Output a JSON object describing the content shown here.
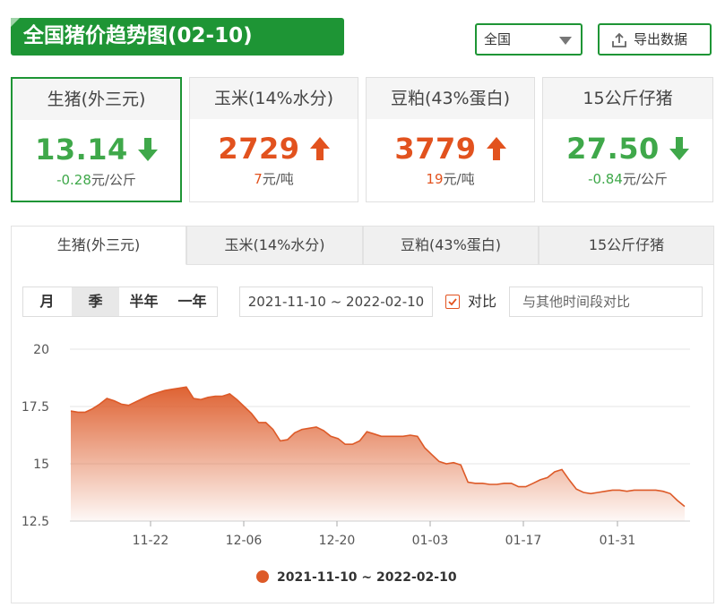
{
  "header": {
    "title": "全国猪价趋势图(02-10)"
  },
  "region": {
    "value": "全国"
  },
  "export": {
    "label": "导出数据"
  },
  "cards": [
    {
      "name": "生猪(外三元)",
      "price": "13.14",
      "direction": "down",
      "change_value": "-0.28",
      "change_unit": "元/公斤"
    },
    {
      "name": "玉米(14%水分)",
      "price": "2729",
      "direction": "up",
      "change_value": "7",
      "change_unit": "元/吨"
    },
    {
      "name": "豆粕(43%蛋白)",
      "price": "3779",
      "direction": "up",
      "change_value": "19",
      "change_unit": "元/吨"
    },
    {
      "name": "15公斤仔猪",
      "price": "27.50",
      "direction": "down",
      "change_value": "-0.84",
      "change_unit": "元/公斤"
    }
  ],
  "tabs": [
    "生猪(外三元)",
    "玉米(14%水分)",
    "豆粕(43%蛋白)",
    "15公斤仔猪"
  ],
  "periods": [
    "月",
    "季",
    "半年",
    "一年"
  ],
  "active_period": "季",
  "date_range": "2021-11-10 ~ 2022-02-10",
  "compare": {
    "checked": true,
    "label": "对比",
    "placeholder": "与其他时间段对比"
  },
  "colors": {
    "green": "#1e9535",
    "up": "#e2521e",
    "down": "#3fa84a",
    "series": "#dd5a28"
  },
  "chart_data": {
    "type": "area",
    "x_ticks": [
      "11-22",
      "12-06",
      "12-20",
      "01-03",
      "01-17",
      "01-31"
    ],
    "y_ticks": [
      "20",
      "17.5",
      "15",
      "12.5"
    ],
    "ylim": [
      12.5,
      20
    ],
    "grid": true,
    "legend_position": "bottom",
    "series": [
      {
        "name": "2021-11-10 ~ 2022-02-10",
        "values": [
          17.3,
          17.25,
          17.25,
          17.4,
          17.6,
          17.85,
          17.75,
          17.6,
          17.55,
          17.7,
          17.85,
          18.0,
          18.1,
          18.2,
          18.25,
          18.3,
          18.35,
          17.85,
          17.8,
          17.9,
          17.95,
          17.95,
          18.05,
          17.8,
          17.5,
          17.2,
          16.8,
          16.8,
          16.5,
          16.0,
          16.05,
          16.35,
          16.5,
          16.55,
          16.6,
          16.45,
          16.2,
          16.1,
          15.85,
          15.85,
          16.0,
          16.4,
          16.3,
          16.2,
          16.2,
          16.2,
          16.2,
          16.25,
          16.2,
          15.7,
          15.4,
          15.1,
          15.0,
          15.05,
          14.95,
          14.2,
          14.15,
          14.15,
          14.1,
          14.1,
          14.15,
          14.15,
          14.0,
          14.0,
          14.15,
          14.3,
          14.4,
          14.65,
          14.75,
          14.3,
          13.9,
          13.75,
          13.7,
          13.75,
          13.8,
          13.85,
          13.85,
          13.8,
          13.85,
          13.85,
          13.85,
          13.85,
          13.8,
          13.7,
          13.4,
          13.14
        ]
      }
    ]
  }
}
